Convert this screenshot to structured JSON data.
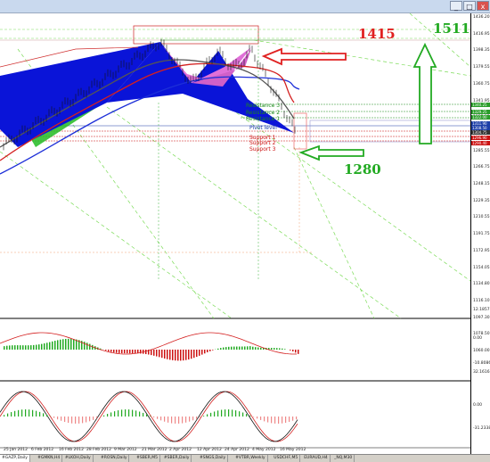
{
  "price_axis": [
    "1436.20",
    "1416.95",
    "1398.35",
    "1379.55",
    "1360.75",
    "1341.95",
    "1323.15",
    "1304.35",
    "1285.55",
    "1266.75",
    "1248.15",
    "1229.35",
    "1210.55",
    "1191.75",
    "1172.95",
    "1154.05",
    "1134.80",
    "1116.10",
    "1097.30",
    "1078.50",
    "1060.00"
  ],
  "price_tags": [
    {
      "text": "1340.25",
      "color": "#2a9d2a"
    },
    {
      "text": "1329.25",
      "color": "#2a9d2a"
    },
    {
      "text": "1322.00",
      "color": "#2a9d2a"
    },
    {
      "text": "1311.90",
      "color": "#1d3fa8"
    },
    {
      "text": "1308.50",
      "color": "#1d3fa8"
    },
    {
      "text": "1304.75",
      "color": "#333333"
    },
    {
      "text": "1296.90",
      "color": "#cc1111"
    },
    {
      "text": "1290.40",
      "color": "#cc1111"
    }
  ],
  "indicator1_axis": [
    "12.1857",
    "0.00",
    "-10.8086"
  ],
  "indicator2_axis": [
    "32.1616",
    "0.00",
    "-31.2338"
  ],
  "date_axis": [
    "25 Jan 2012",
    "6 Feb 2012",
    "16 Feb 2012",
    "28 Feb 2012",
    "9 Mar 2012",
    "21 Mar 2012",
    "2 Apr 2012",
    "12 Apr 2012",
    "24 Apr 2012",
    "4 May 2012",
    "16 May 2012"
  ],
  "level_labels": {
    "resistance3": "Resistance 3",
    "resistance2": "Resistance 2",
    "resistance1": "Resistance 1",
    "pivot": "Pivot level",
    "support1": "Support 1",
    "support2": "Support 2",
    "support3": "Support 3"
  },
  "annotations": {
    "n1415": "1415",
    "n1511": "1511",
    "n1280": "1280"
  },
  "tabs": [
    "#GAZP,Daily",
    "#GMKN,H4",
    "#LKOH,Daily",
    "#ROSN,Daily",
    "#SBER,M5",
    "#SBER,Daily",
    "#SNGS,Daily",
    "#VTBR,Weekly",
    "USDCHF,M5",
    "EURAUD,H4",
    "_NQ,M30"
  ],
  "active_tab_index": 0,
  "window_buttons": {
    "minimize": "_",
    "maximize": "□",
    "close": "x"
  },
  "colors": {
    "bull_pattern": "#0a14d8",
    "bear_pattern": "#e070d8",
    "arrow_red": "#e02020",
    "arrow_green": "#22aa22",
    "resistance": "#1a8a1a",
    "support": "#dd1111",
    "pivot": "#1d3fa8"
  }
}
